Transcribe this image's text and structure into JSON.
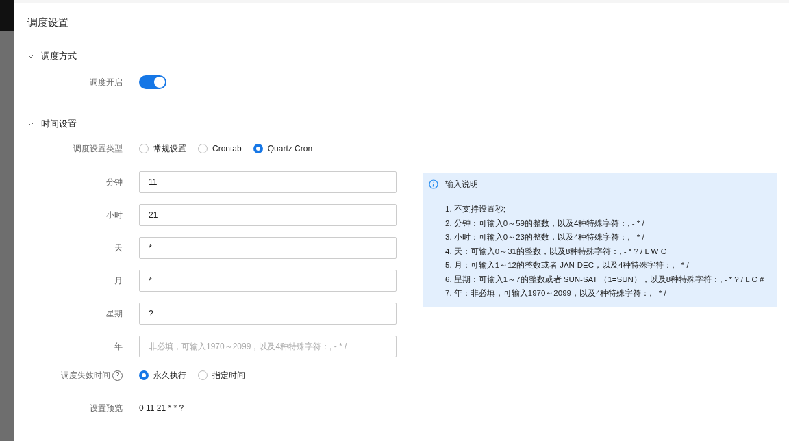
{
  "title": "调度设置",
  "sections": [
    {
      "title": "调度方式",
      "expanded": true,
      "rows": [
        {
          "kind": "switch",
          "label": "调度开启",
          "on": true
        }
      ]
    },
    {
      "title": "时间设置",
      "expanded": true,
      "rows": [
        {
          "kind": "radio",
          "label": "调度设置类型",
          "options": [
            {
              "label": "常规设置",
              "selected": false
            },
            {
              "label": "Crontab",
              "selected": false
            },
            {
              "label": "Quartz Cron",
              "selected": true
            }
          ]
        },
        {
          "kind": "input",
          "label": "分钟",
          "value": "11"
        },
        {
          "kind": "input",
          "label": "小时",
          "value": "21"
        },
        {
          "kind": "input",
          "label": "天",
          "value": "*"
        },
        {
          "kind": "input",
          "label": "月",
          "value": "*"
        },
        {
          "kind": "input",
          "label": "星期",
          "value": "?"
        },
        {
          "kind": "input",
          "label": "年",
          "placeholder": "非必填，可输入1970～2099，以及4种特殊字符：, - * /"
        },
        {
          "kind": "radio",
          "label": "调度失效时间",
          "help": "?",
          "options": [
            {
              "label": "永久执行",
              "selected": true
            },
            {
              "label": "指定时间",
              "selected": false
            }
          ]
        },
        {
          "kind": "text",
          "label": "设置预览",
          "value": "0 11 21 * * ?"
        }
      ],
      "note": {
        "title": "输入说明",
        "lines": [
          "1. 不支持设置秒;",
          "2. 分钟：可输入0～59的整数，以及4种特殊字符：, - * /",
          "3. 小时：可输入0～23的整数，以及4种特殊字符：, - * /",
          "4. 天：可输入0～31的整数，以及8种特殊字符：, - * ? / L W C",
          "5. 月：可输入1～12的整数或者 JAN-DEC，以及4种特殊字符：, - * /",
          "6. 星期：可输入1～7的整数或者 SUN-SAT （1=SUN），以及8种特殊字符：, - * ? / L C #",
          "7. 年：非必填，可输入1970～2099，以及4种特殊字符：, - * /"
        ]
      }
    }
  ]
}
